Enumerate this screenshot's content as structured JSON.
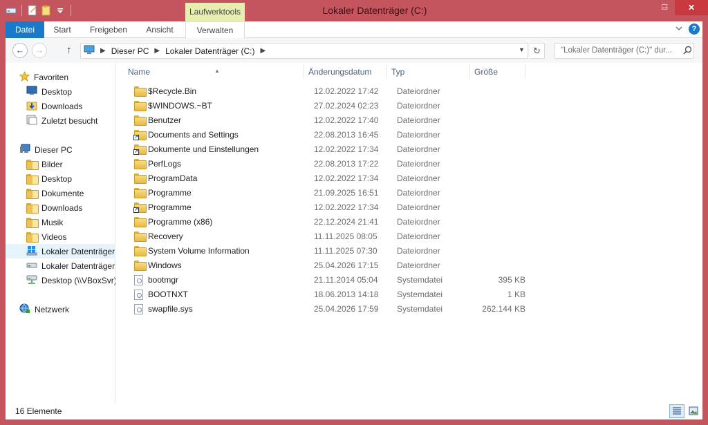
{
  "window": {
    "title": "Lokaler Datenträger (C:)",
    "context_tab_header": "Laufwerktools",
    "minimize": "–",
    "maximize": "□",
    "close": "✕"
  },
  "ribbon": {
    "tabs": [
      {
        "label": "Datei"
      },
      {
        "label": "Start"
      },
      {
        "label": "Freigeben"
      },
      {
        "label": "Ansicht"
      },
      {
        "label": "Verwalten"
      }
    ],
    "help": "?",
    "expand_icon": "chevron-down-icon"
  },
  "navbar": {
    "back": "←",
    "forward": "→",
    "up": "↑",
    "breadcrumb": [
      "Dieser PC",
      "Lokaler Datenträger (C:)"
    ],
    "refresh": "↻",
    "search_placeholder": "\"Lokaler Datenträger (C:)\" dur..."
  },
  "sidebar": {
    "favorites": {
      "label": "Favoriten",
      "items": [
        "Desktop",
        "Downloads",
        "Zuletzt besucht"
      ]
    },
    "this_pc": {
      "label": "Dieser PC",
      "items": [
        "Bilder",
        "Desktop",
        "Dokumente",
        "Downloads",
        "Musik",
        "Videos",
        "Lokaler Datenträger",
        "Lokaler Datenträger",
        "Desktop (\\\\VBoxSvr)"
      ]
    },
    "network": {
      "label": "Netzwerk"
    }
  },
  "columns": {
    "name": "Name",
    "date": "Änderungsdatum",
    "type": "Typ",
    "size": "Größe"
  },
  "files": [
    {
      "name": "$Recycle.Bin",
      "date": "12.02.2022 17:42",
      "type": "Dateiordner",
      "size": "",
      "icon": "folder-icon"
    },
    {
      "name": "$WINDOWS.~BT",
      "date": "27.02.2024 02:23",
      "type": "Dateiordner",
      "size": "",
      "icon": "folder-icon"
    },
    {
      "name": "Benutzer",
      "date": "12.02.2022 17:40",
      "type": "Dateiordner",
      "size": "",
      "icon": "folder-icon"
    },
    {
      "name": "Documents and Settings",
      "date": "22.08.2013 16:45",
      "type": "Dateiordner",
      "size": "",
      "icon": "shortcut-icon"
    },
    {
      "name": "Dokumente und Einstellungen",
      "date": "12.02.2022 17:34",
      "type": "Dateiordner",
      "size": "",
      "icon": "shortcut-icon"
    },
    {
      "name": "PerfLogs",
      "date": "22.08.2013 17:22",
      "type": "Dateiordner",
      "size": "",
      "icon": "folder-icon"
    },
    {
      "name": "ProgramData",
      "date": "12.02.2022 17:34",
      "type": "Dateiordner",
      "size": "",
      "icon": "folder-icon"
    },
    {
      "name": "Programme",
      "date": "21.09.2025 16:51",
      "type": "Dateiordner",
      "size": "",
      "icon": "folder-icon"
    },
    {
      "name": "Programme",
      "date": "12.02.2022 17:34",
      "type": "Dateiordner",
      "size": "",
      "icon": "shortcut-icon"
    },
    {
      "name": "Programme (x86)",
      "date": "22.12.2024 21:41",
      "type": "Dateiordner",
      "size": "",
      "icon": "folder-icon"
    },
    {
      "name": "Recovery",
      "date": "11.11.2025 08:05",
      "type": "Dateiordner",
      "size": "",
      "icon": "folder-icon"
    },
    {
      "name": "System Volume Information",
      "date": "11.11.2025 07:30",
      "type": "Dateiordner",
      "size": "",
      "icon": "folder-icon"
    },
    {
      "name": "Windows",
      "date": "25.04.2026 17:15",
      "type": "Dateiordner",
      "size": "",
      "icon": "folder-icon"
    },
    {
      "name": "bootmgr",
      "date": "21.11.2014 05:04",
      "type": "Systemdatei",
      "size": "395 KB",
      "icon": "system-file-icon"
    },
    {
      "name": "BOOTNXT",
      "date": "18.06.2013 14:18",
      "type": "Systemdatei",
      "size": "1 KB",
      "icon": "system-file-icon"
    },
    {
      "name": "swapfile.sys",
      "date": "25.04.2026 17:59",
      "type": "Systemdatei",
      "size": "262.144 KB",
      "icon": "system-file-icon"
    }
  ],
  "status": {
    "count": "16 Elemente"
  },
  "colors": {
    "frame": "#c4545d",
    "accent": "#1979ca",
    "context_tab": "#e7efb0",
    "selected": "#e5f3fb"
  }
}
